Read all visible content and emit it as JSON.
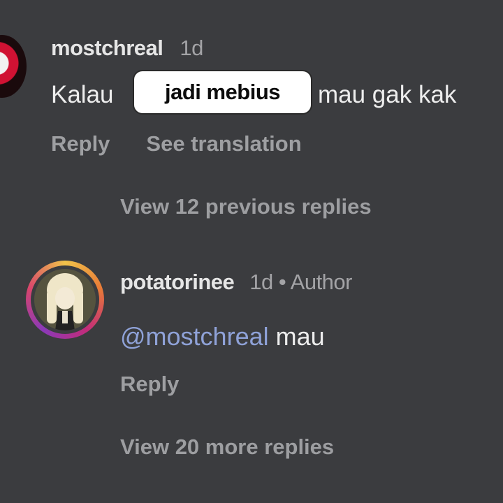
{
  "comment1": {
    "username": "mostchreal",
    "time": "1d",
    "text_before": "Kalau",
    "sticker_text": "jadi mebius",
    "text_after": "mau gak kak",
    "reply_label": "Reply",
    "see_translation_label": "See translation"
  },
  "view_previous_label": "View 12 previous replies",
  "comment2": {
    "username": "potatorinee",
    "meta": "1d • Author",
    "mention": "@mostchreal",
    "text": "mau",
    "reply_label": "Reply"
  },
  "view_more_label": "View 20 more replies"
}
